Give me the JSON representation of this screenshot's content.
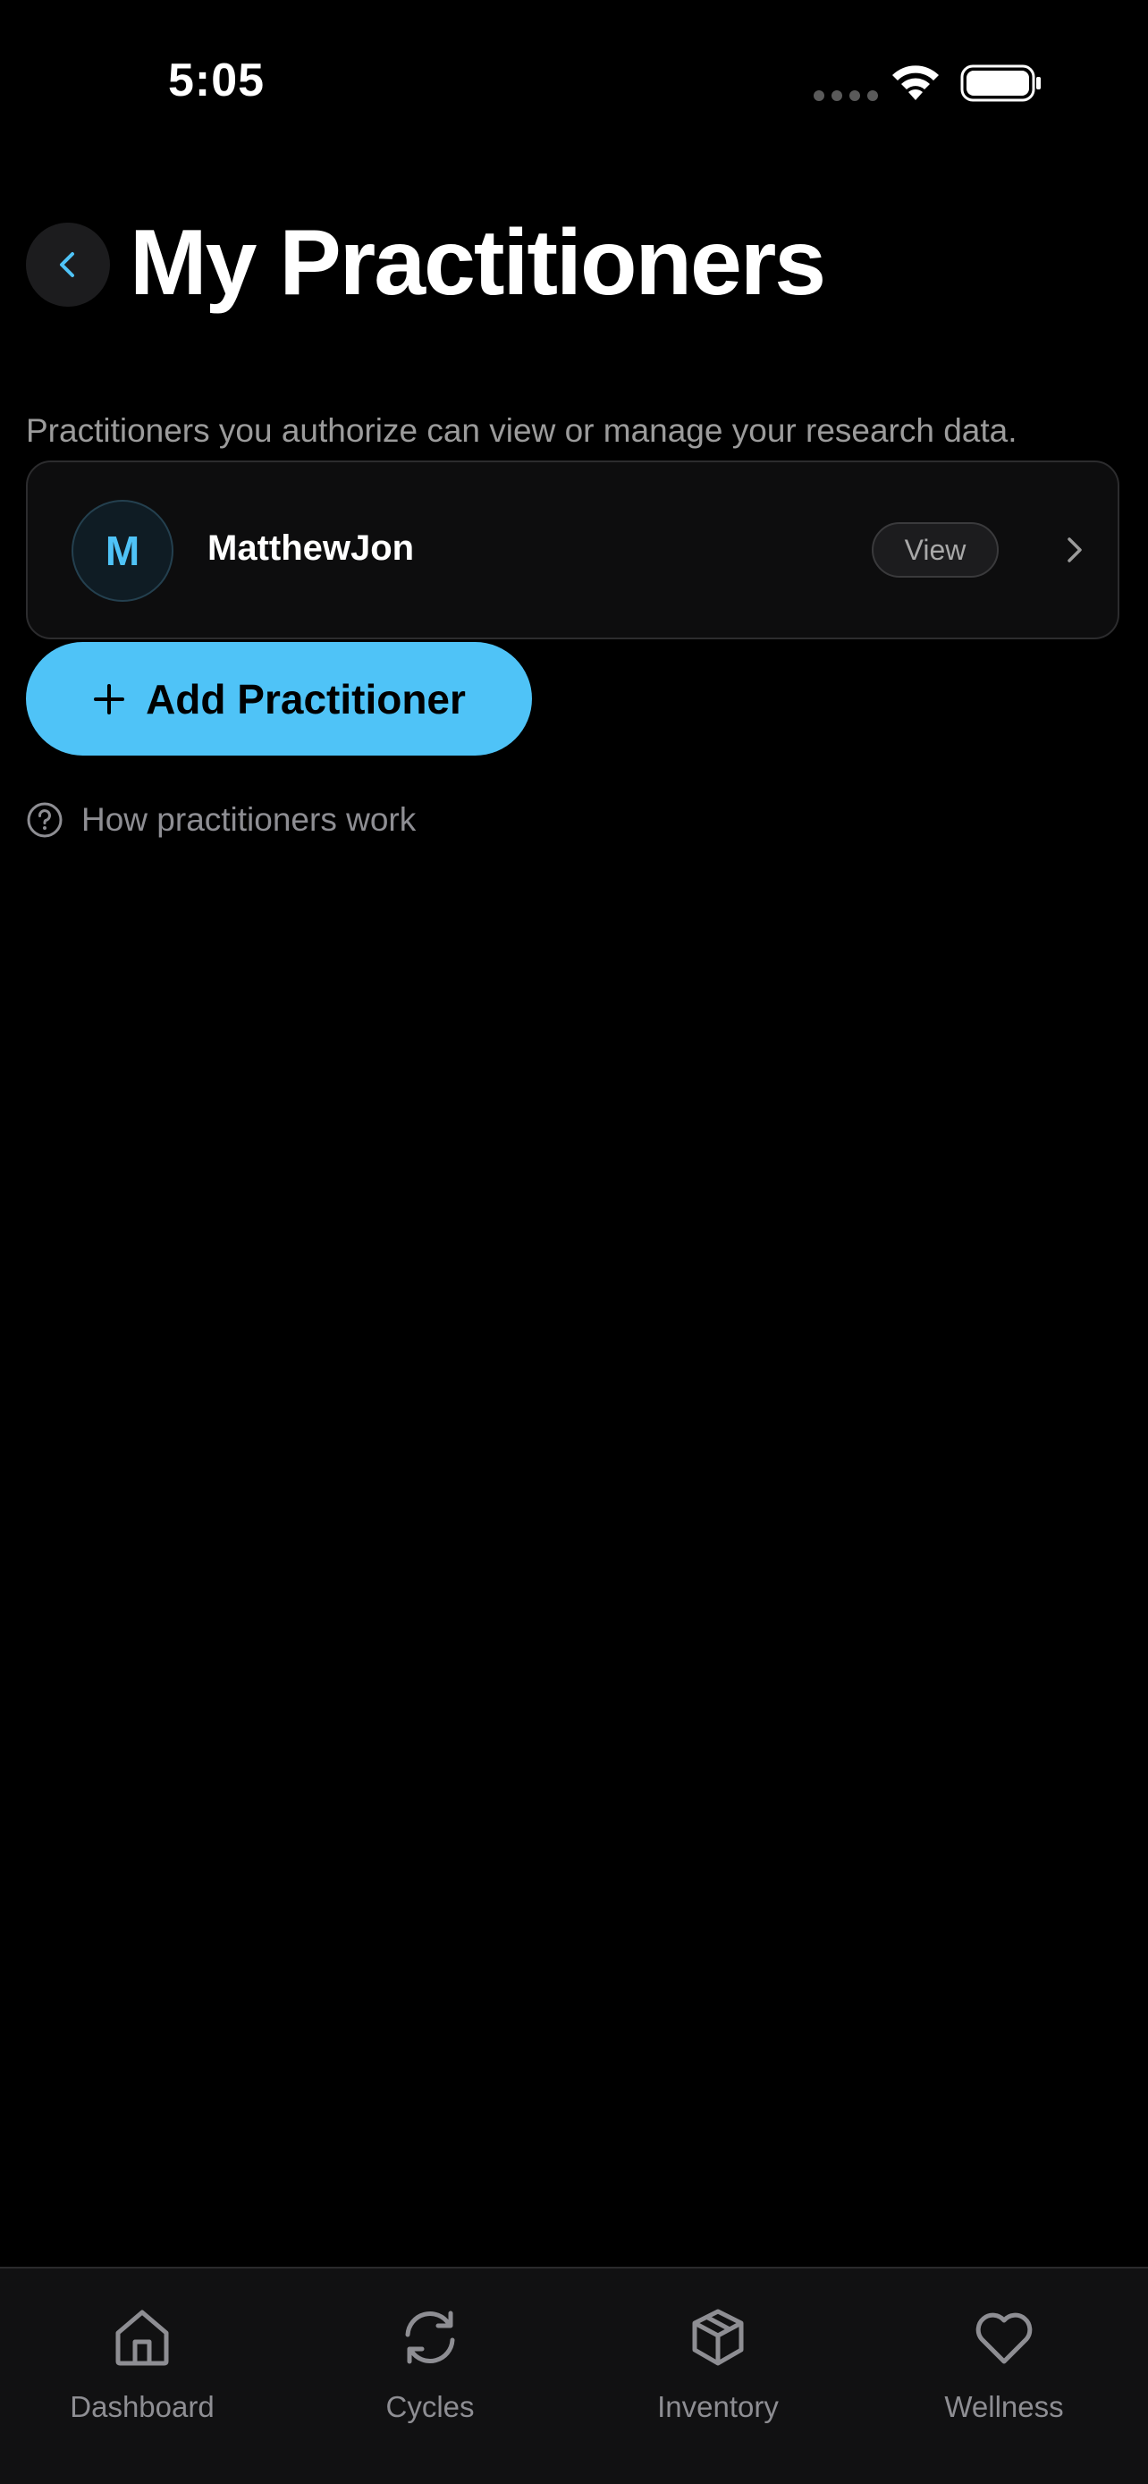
{
  "status_bar": {
    "time": "5:05"
  },
  "header": {
    "title": "My Practitioners",
    "back_icon": "chevron-left-icon"
  },
  "subtitle": "Practitioners you authorize can view or manage your research data.",
  "practitioners": [
    {
      "initial": "M",
      "name": "MatthewJon",
      "action_label": "View"
    }
  ],
  "add_button": {
    "icon": "plus-icon",
    "label": "Add Practitioner"
  },
  "help_link": {
    "icon": "question-circle-icon",
    "label": "How practitioners work"
  },
  "tab_bar": {
    "tabs": [
      {
        "label": "Dashboard",
        "icon": "home-icon"
      },
      {
        "label": "Cycles",
        "icon": "refresh-icon"
      },
      {
        "label": "Inventory",
        "icon": "box-icon"
      },
      {
        "label": "Wellness",
        "icon": "heart-icon"
      }
    ]
  },
  "colors": {
    "accent": "#4fc3f7",
    "background": "#000000",
    "card": "#0d0d0e",
    "muted_text": "#9b9b9b"
  }
}
